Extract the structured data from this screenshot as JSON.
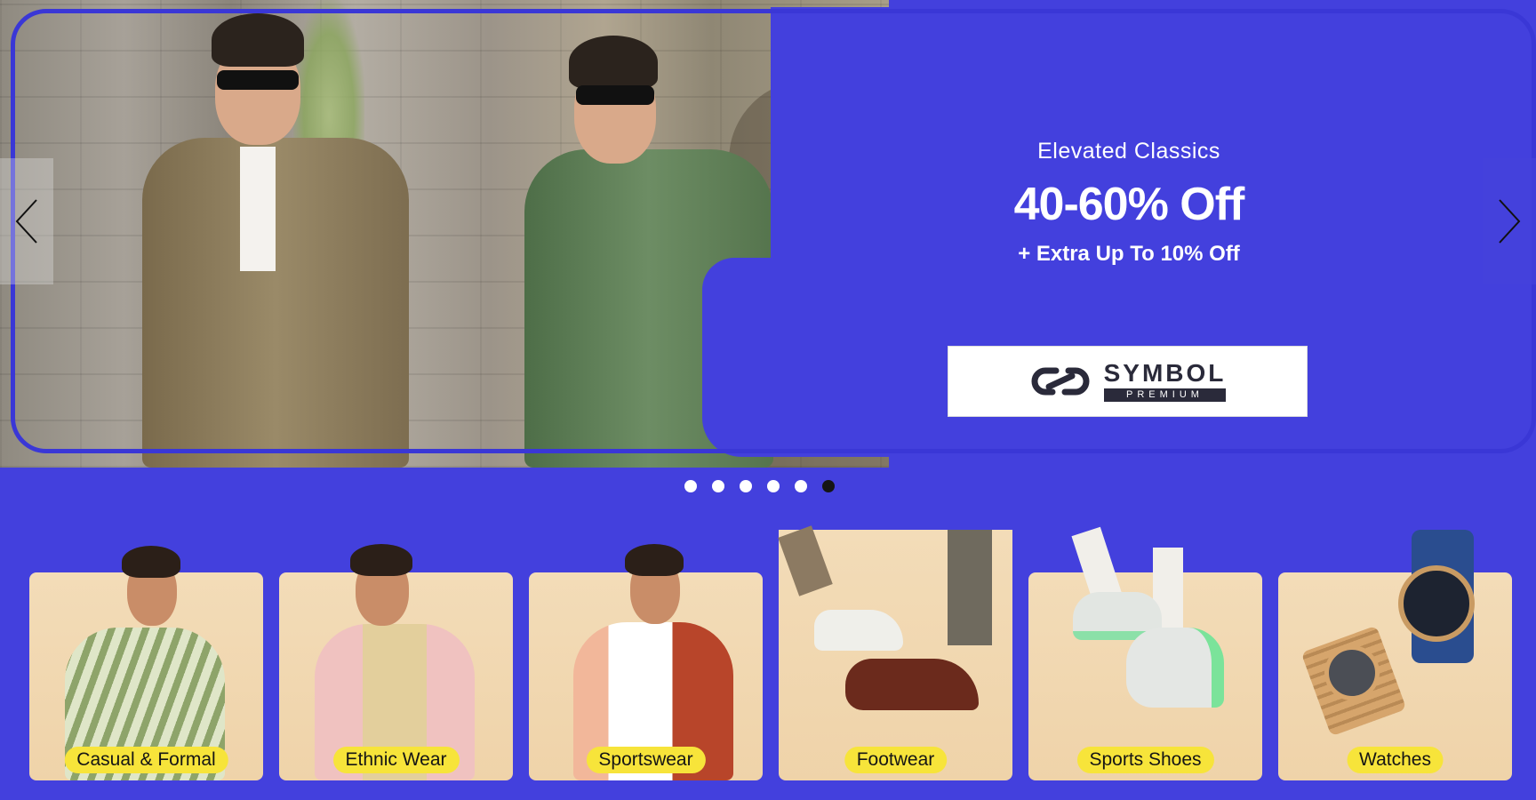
{
  "hero": {
    "subtitle": "Elevated Classics",
    "title": "40-60% Off",
    "extra": "+ Extra Up To 10% Off",
    "brand": {
      "name": "SYMBOL",
      "tag": "PREMIUM"
    },
    "prev_icon": "chevron-left-icon",
    "next_icon": "chevron-right-icon"
  },
  "carousel": {
    "slides": 6,
    "active_index": 6
  },
  "categories": [
    {
      "label": "Casual & Formal"
    },
    {
      "label": "Ethnic Wear"
    },
    {
      "label": "Sportswear"
    },
    {
      "label": "Footwear"
    },
    {
      "label": "Sports Shoes"
    },
    {
      "label": "Watches"
    }
  ],
  "colors": {
    "brand_blue": "#4340dd",
    "pill_yellow": "#f7e43a",
    "card_beige": "#f0d5ad"
  }
}
